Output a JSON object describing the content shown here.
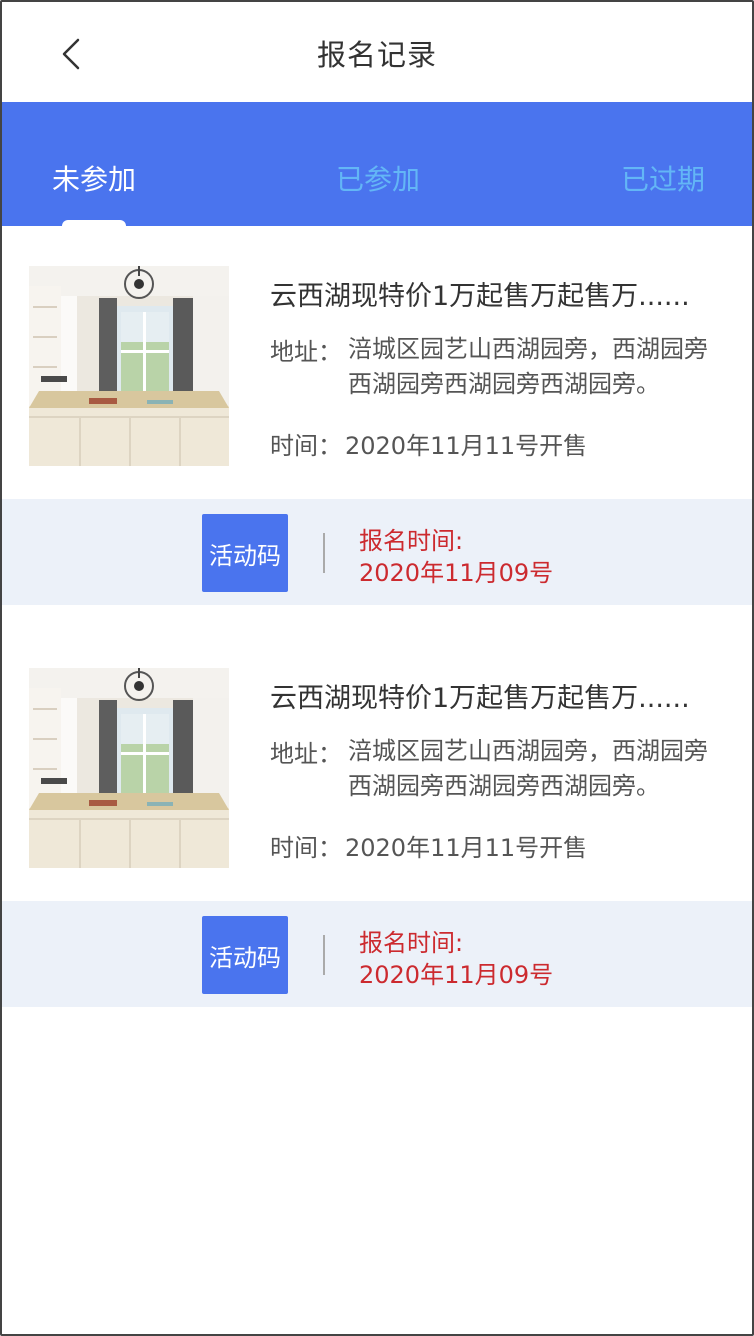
{
  "header": {
    "title": "报名记录",
    "back_icon": "chevron-left-icon"
  },
  "tabs": [
    {
      "label": "未参加",
      "active": true
    },
    {
      "label": "已参加",
      "active": false
    },
    {
      "label": "已过期",
      "active": false
    }
  ],
  "colors": {
    "primary": "#4a74ee",
    "inactive_tab": "#63b6f6",
    "accent_red": "#cc2a2f",
    "footer_bg": "#ecf1f9"
  },
  "records": [
    {
      "image": "room-photo",
      "title": "云西湖现特价1万起售万起售万......",
      "address_label": "地址：",
      "address": "涪城区园艺山西湖园旁，西湖园旁西湖园旁西湖园旁西湖园旁。",
      "time_label": "时间：",
      "time": "2020年11月11号开售",
      "code_button": "活动码",
      "signup_label": "报名时间:",
      "signup_time": "2020年11月09号"
    },
    {
      "image": "room-photo",
      "title": "云西湖现特价1万起售万起售万......",
      "address_label": "地址：",
      "address": "涪城区园艺山西湖园旁，西湖园旁西湖园旁西湖园旁西湖园旁。",
      "time_label": "时间：",
      "time": "2020年11月11号开售",
      "code_button": "活动码",
      "signup_label": "报名时间:",
      "signup_time": "2020年11月09号"
    }
  ]
}
